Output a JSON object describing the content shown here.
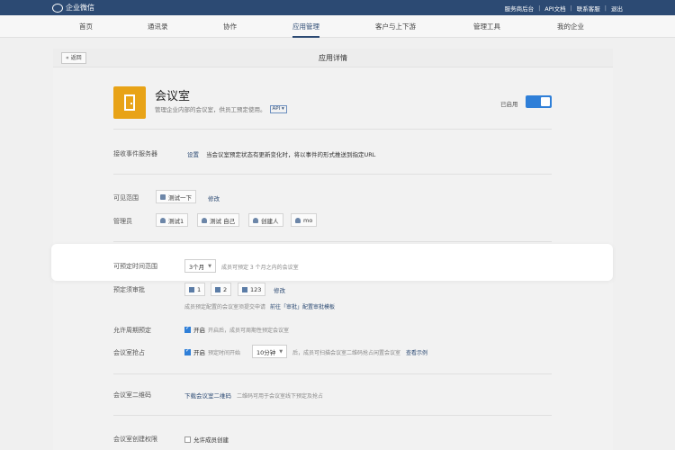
{
  "topbar": {
    "brand": "企业微信",
    "links": [
      "服务商后台",
      "API文档",
      "联系客服",
      "退出"
    ]
  },
  "nav": {
    "items": [
      {
        "label": "首页",
        "active": false
      },
      {
        "label": "通讯录",
        "active": false
      },
      {
        "label": "协作",
        "active": false
      },
      {
        "label": "应用管理",
        "active": true
      },
      {
        "label": "客户与上下游",
        "active": false
      },
      {
        "label": "管理工具",
        "active": false
      },
      {
        "label": "我的企业",
        "active": false
      }
    ]
  },
  "panel": {
    "title": "应用详情",
    "back": "« 返回"
  },
  "app": {
    "name": "会议室",
    "description": "管理企业内部的会议室，供员工预定使用。",
    "api_tag": "API ▾",
    "status_label": "已启用",
    "enabled": true
  },
  "event_server": {
    "label": "接收事件服务器",
    "action": "设置",
    "desc": "当会议室预定状态有更新变化时，将以事件的形式推送到指定URL"
  },
  "visibility": {
    "label": "可见范围",
    "items": [
      "测试一下"
    ],
    "edit": "修改"
  },
  "admins": {
    "label": "管理员",
    "items": [
      "测试1",
      "测试 自己",
      "创建人",
      "mo"
    ]
  },
  "booking_range": {
    "label": "可预定时间范围",
    "value": "3个月",
    "hint": "成员可预定 3 个月之内的会议室"
  },
  "approval": {
    "label": "预定须审批",
    "items": [
      "1",
      "2",
      "123"
    ],
    "edit": "修改",
    "hint": "成员预定配置的会议室须提交申请",
    "link": "前往「审批」配置审批模板"
  },
  "periodic": {
    "label": "允许周期预定",
    "checkbox": "开启",
    "hint": "开启后，成员可周期性预定会议室"
  },
  "grab": {
    "label": "会议室抢占",
    "checkbox": "开启",
    "hint_before": "预定时间开始",
    "value": "10分钟",
    "hint_after": "后，成员可扫描会议室二维码抢占闲置会议室",
    "link": "查看示例"
  },
  "qrcode": {
    "label": "会议室二维码",
    "link": "下载会议室二维码",
    "hint": "二维码可用于会议室线下预定及抢占"
  },
  "create_perm": {
    "label": "会议室创建权限",
    "checkbox": "允许成员创建"
  },
  "colors": {
    "topbar": "#2c4a73",
    "accent": "#2f7fd8",
    "app_icon": "#e8a317"
  }
}
